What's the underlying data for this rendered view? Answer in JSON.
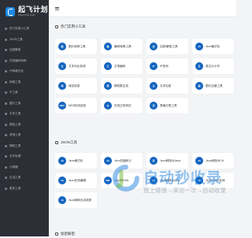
{
  "brand": {
    "title": "起飞计划",
    "subtitle": "www.k48.com"
  },
  "sidebar": {
    "items": [
      {
        "label": "热门实用小工具"
      },
      {
        "label": "JSON工具"
      },
      {
        "label": "加密解密"
      },
      {
        "label": "在线编码转换"
      },
      {
        "label": "代码格式化"
      },
      {
        "label": "网络工具"
      },
      {
        "label": "IP工具"
      },
      {
        "label": "图片工具"
      },
      {
        "label": "文本工具"
      },
      {
        "label": "颜色工具"
      },
      {
        "label": "其他工具"
      },
      {
        "label": "随机工具"
      },
      {
        "label": "文字处理"
      },
      {
        "label": "计算器"
      },
      {
        "label": "生活工具"
      },
      {
        "label": "更多工具"
      }
    ]
  },
  "sections": {
    "popular": {
      "title": "热门实用小工具",
      "cards": [
        {
          "icon": "图",
          "label": "图片转换工具"
        },
        {
          "icon": "编",
          "label": "编码转换工具"
        },
        {
          "icon": "加",
          "label": "加密/解密工具"
        },
        {
          "icon": "JS",
          "label": "Json格式化"
        },
        {
          "icon": "文",
          "label": "文本对比检测"
        },
        {
          "icon": "五",
          "label": "五笔编码"
        },
        {
          "icon": "IP",
          "label": "IP查询"
        },
        {
          "icon": "英",
          "label": "英文大小写"
        },
        {
          "icon": "域",
          "label": "域名信息"
        },
        {
          "icon": "随",
          "label": "随机数生成"
        },
        {
          "icon": "文",
          "label": "文本加密"
        },
        {
          "icon": "图",
          "label": "图片压缩工具"
        },
        {
          "icon": "MD5",
          "label": "MD5在线加密"
        },
        {
          "icon": "在",
          "label": "在线正则测试"
        },
        {
          "icon": "表",
          "label": "表格分割工具"
        }
      ]
    },
    "json": {
      "title": "JSON工具",
      "cards": [
        {
          "icon": "JS",
          "label": "Json格式化"
        },
        {
          "icon": "JS",
          "label": "Json压缩转义"
        },
        {
          "icon": "转",
          "label": "Json转换为Java"
        },
        {
          "icon": "JS",
          "label": "Json转换为C#"
        },
        {
          "icon": "JS",
          "label": "Json在线编辑"
        },
        {
          "icon": "XML",
          "label": "Json转XML"
        },
        {
          "icon": "CS",
          "label": "Json转换为CSV"
        },
        {
          "icon": "JS",
          "label": "Json Excel互转"
        },
        {
          "icon": "JS",
          "label": "Json转换为实体类"
        }
      ]
    },
    "next": {
      "title": "加密解密"
    }
  },
  "watermark": {
    "title": "自动秒收录",
    "subtitle": "放上链接→来访一次→自动收录"
  }
}
